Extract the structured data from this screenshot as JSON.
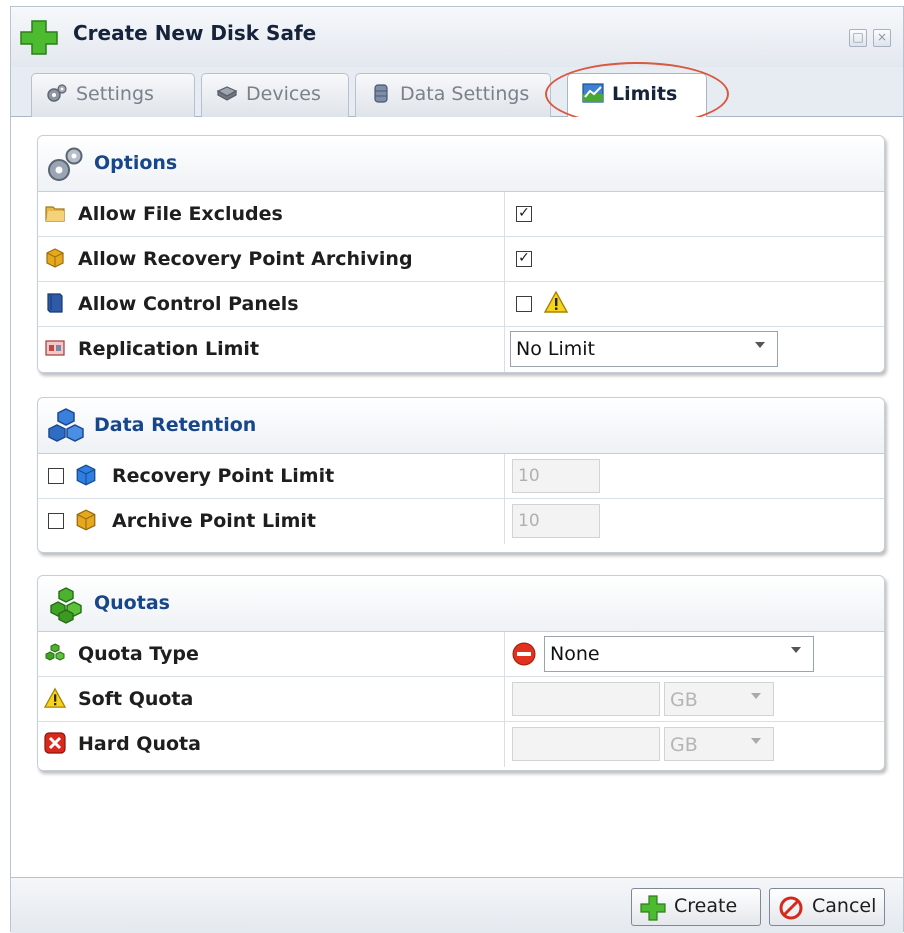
{
  "window": {
    "title": "Create New Disk Safe",
    "restore_glyph": "□",
    "close_glyph": "×"
  },
  "tabs": [
    {
      "label": "Settings",
      "icon": "gears-icon",
      "active": false
    },
    {
      "label": "Devices",
      "icon": "disk-icon",
      "active": false
    },
    {
      "label": "Data Settings",
      "icon": "database-icon",
      "active": false
    },
    {
      "label": "Limits",
      "icon": "chart-icon",
      "active": true
    }
  ],
  "options": {
    "title": "Options",
    "rows": [
      {
        "label": "Allow File Excludes",
        "icon": "folder-icon",
        "checked": true
      },
      {
        "label": "Allow Recovery Point Archiving",
        "icon": "archive-cube-icon",
        "checked": true
      },
      {
        "label": "Allow Control Panels",
        "icon": "book-icon",
        "checked": false,
        "warning": true
      },
      {
        "label": "Replication Limit",
        "icon": "replication-icon",
        "select_value": "No Limit"
      }
    ]
  },
  "retention": {
    "title": "Data Retention",
    "rows": [
      {
        "label": "Recovery Point Limit",
        "icon": "blue-cube-icon",
        "checked": false,
        "value": "10"
      },
      {
        "label": "Archive Point Limit",
        "icon": "gold-cube-icon",
        "checked": false,
        "value": "10"
      }
    ]
  },
  "quotas": {
    "title": "Quotas",
    "rows": [
      {
        "label": "Quota Type",
        "icon": "green-cubes-icon",
        "select_value": "None"
      },
      {
        "label": "Soft Quota",
        "icon": "warning-icon",
        "value": "",
        "unit": "GB"
      },
      {
        "label": "Hard Quota",
        "icon": "error-icon",
        "value": "",
        "unit": "GB"
      }
    ]
  },
  "checkmark_glyph": "✓",
  "footer": {
    "create_label": "Create",
    "cancel_label": "Cancel"
  },
  "colors": {
    "accent": "#17468a",
    "highlight": "#d9593f",
    "create_green": "#3faa2d",
    "cancel_red": "#d32a1d"
  }
}
